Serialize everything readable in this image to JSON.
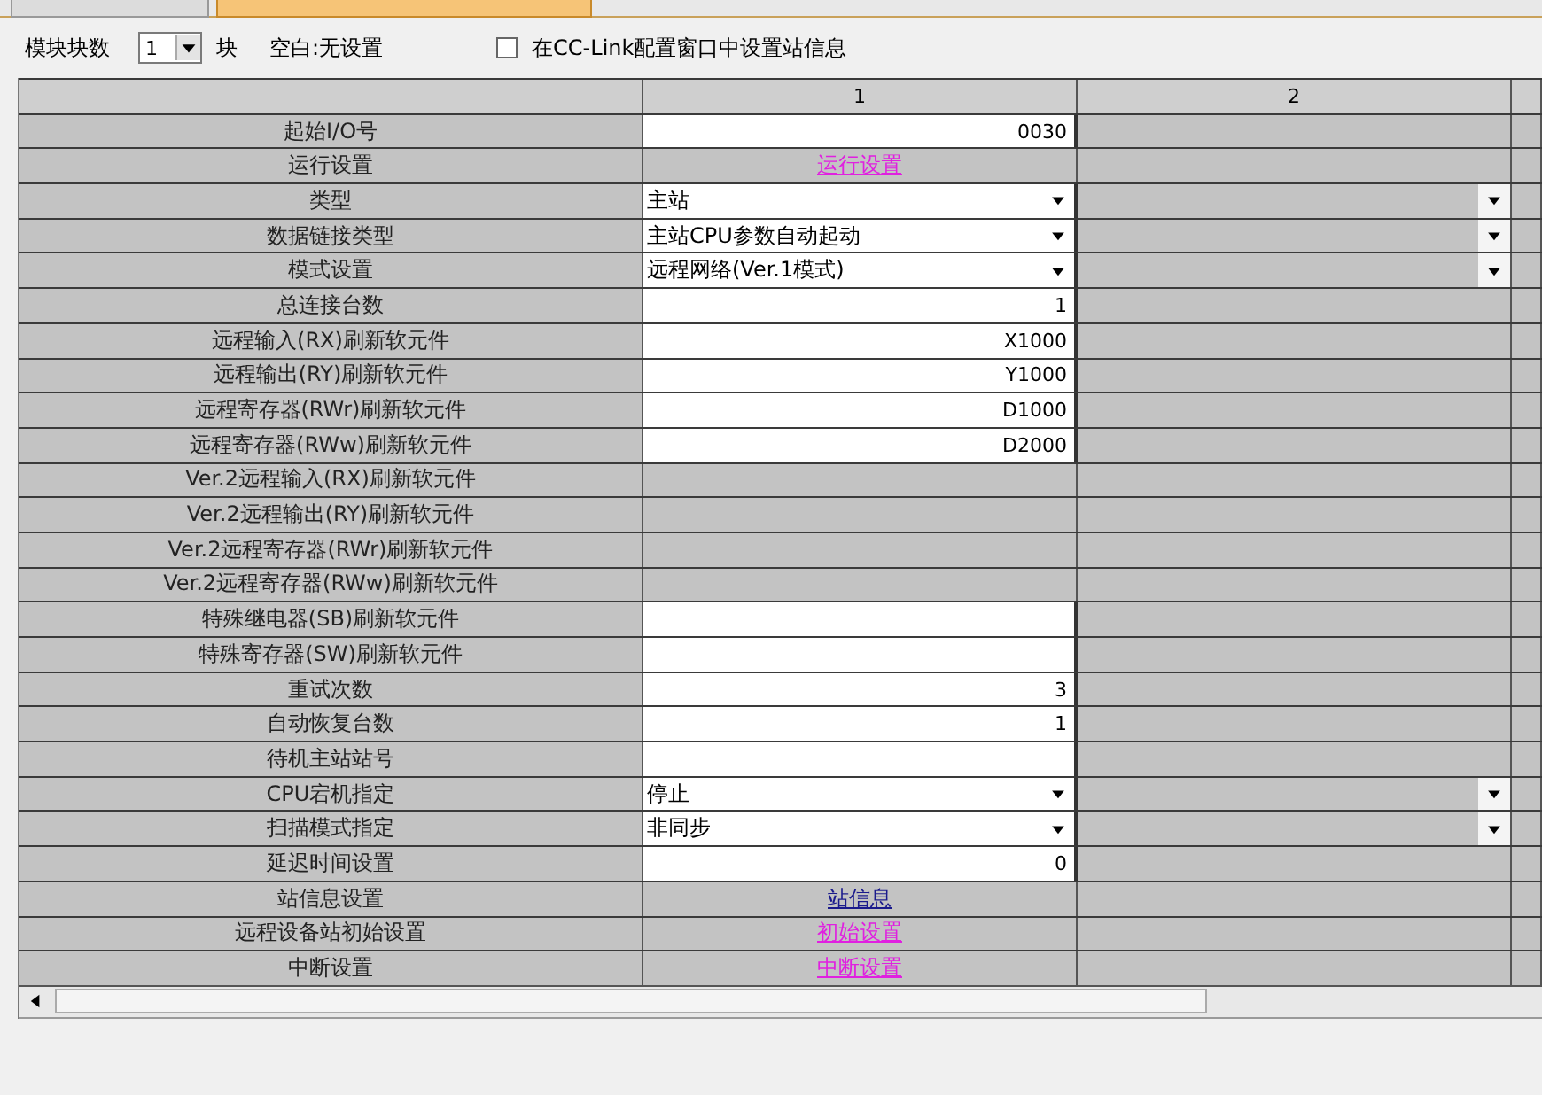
{
  "toolbar": {
    "module_count_label": "模块块数",
    "module_count": "1",
    "unit": "块",
    "blank_note": "空白:无设置",
    "checkbox": {
      "label": "在CC-Link配置窗口中设置站信息",
      "checked": false
    }
  },
  "table": {
    "columns": [
      "1",
      "2"
    ],
    "rows": [
      {
        "label": "起始I/O号",
        "kind": "text",
        "value": "0030"
      },
      {
        "label": "运行设置",
        "kind": "link",
        "value": "运行设置",
        "color": "#e020e0"
      },
      {
        "label": "类型",
        "kind": "select",
        "value": "主站"
      },
      {
        "label": "数据链接类型",
        "kind": "select",
        "value": "主站CPU参数自动起动"
      },
      {
        "label": "模式设置",
        "kind": "select",
        "value": "远程网络(Ver.1模式)"
      },
      {
        "label": "总连接台数",
        "kind": "text",
        "value": "1"
      },
      {
        "label": "远程输入(RX)刷新软元件",
        "kind": "text",
        "value": "X1000"
      },
      {
        "label": "远程输出(RY)刷新软元件",
        "kind": "text",
        "value": "Y1000"
      },
      {
        "label": "远程寄存器(RWr)刷新软元件",
        "kind": "text",
        "value": "D1000"
      },
      {
        "label": "远程寄存器(RWw)刷新软元件",
        "kind": "text",
        "value": "D2000"
      },
      {
        "label": "Ver.2远程输入(RX)刷新软元件",
        "kind": "disabled"
      },
      {
        "label": "Ver.2远程输出(RY)刷新软元件",
        "kind": "disabled"
      },
      {
        "label": "Ver.2远程寄存器(RWr)刷新软元件",
        "kind": "disabled"
      },
      {
        "label": "Ver.2远程寄存器(RWw)刷新软元件",
        "kind": "disabled"
      },
      {
        "label": "特殊继电器(SB)刷新软元件",
        "kind": "text"
      },
      {
        "label": "特殊寄存器(SW)刷新软元件",
        "kind": "text"
      },
      {
        "label": "重试次数",
        "kind": "text",
        "value": "3"
      },
      {
        "label": "自动恢复台数",
        "kind": "text",
        "value": "1"
      },
      {
        "label": "待机主站站号",
        "kind": "text"
      },
      {
        "label": "CPU宕机指定",
        "kind": "select",
        "value": "停止"
      },
      {
        "label": "扫描模式指定",
        "kind": "select",
        "value": "非同步"
      },
      {
        "label": "延迟时间设置",
        "kind": "text",
        "value": "0"
      },
      {
        "label": "站信息设置",
        "kind": "link",
        "value": "站信息",
        "color": "#1a1a8c"
      },
      {
        "label": "远程设备站初始设置",
        "kind": "link",
        "value": "初始设置",
        "color": "#e020e0"
      },
      {
        "label": "中断设置",
        "kind": "link",
        "value": "中断设置",
        "color": "#e020e0"
      }
    ]
  }
}
